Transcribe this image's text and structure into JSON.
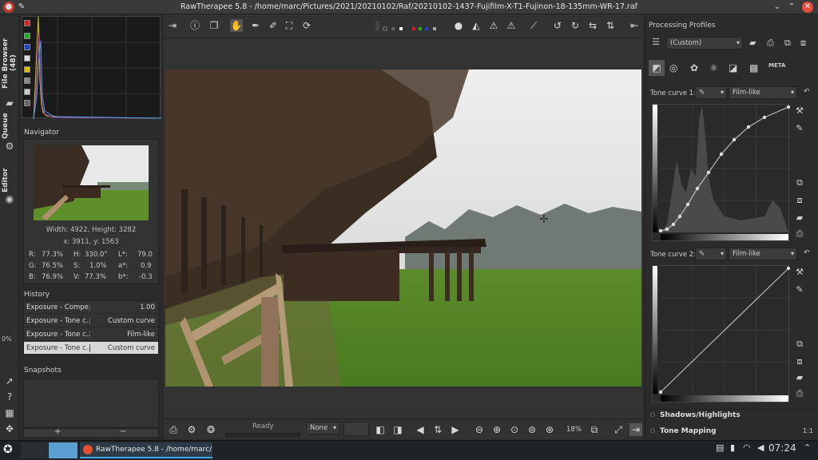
{
  "window": {
    "title": "RawTherapee 5.8 - /home/marc/Pictures/2021/20210102/Raf/20210102-1437-Fujifilm-X-T1-Fujinon-18-135mm-WR-17.raf"
  },
  "side_tabs": {
    "file_browser": "File Browser (48)",
    "queue": "Queue",
    "editor": "Editor",
    "zoom_pct": "0%"
  },
  "navigator": {
    "label": "Navigator",
    "size": "Width: 4922, Height: 3282",
    "coords": "x: 3911, y: 1563",
    "r": "R:",
    "r_val": "77.3%",
    "h": "H:",
    "h_val": "330.0°",
    "l": "L*:",
    "l_val": "79.0",
    "g": "G:",
    "g_val": "76.5%",
    "s": "S:",
    "s_val": "1.0%",
    "a": "a*:",
    "a_val": "0.9",
    "b": "B:",
    "b_val": "76.9%",
    "v": "V:",
    "v_val": "77.3%",
    "bb": "b*:",
    "bb_val": "-0.3"
  },
  "history": {
    "label": "History",
    "items": [
      {
        "name": "Exposure - Compe...",
        "value": "1.00"
      },
      {
        "name": "Exposure - Tone c...",
        "value": "Custom curve"
      },
      {
        "name": "Exposure - Tone c...",
        "value": "Film-like"
      },
      {
        "name": "Exposure - Tone c...",
        "value": "Custom curve"
      }
    ]
  },
  "snapshots": {
    "label": "Snapshots",
    "add": "+",
    "remove": "−"
  },
  "bottom": {
    "status": "Ready",
    "none_select": "None",
    "zoom": "18%"
  },
  "profiles": {
    "label": "Processing Profiles",
    "selected": "(Custom)",
    "curve1_label": "Tone curve 1:",
    "curve1_mode": "Film-like",
    "curve2_label": "Tone curve 2:",
    "curve2_mode": "Film-like",
    "meta_tab": "META"
  },
  "sections": {
    "shadows": "Shadows/Highlights",
    "tone_mapping": "Tone Mapping",
    "ratio": "1:1"
  },
  "taskbar": {
    "app": "RawTherapee 5.8 - /home/marc/Pi...",
    "clock": "07:24"
  }
}
